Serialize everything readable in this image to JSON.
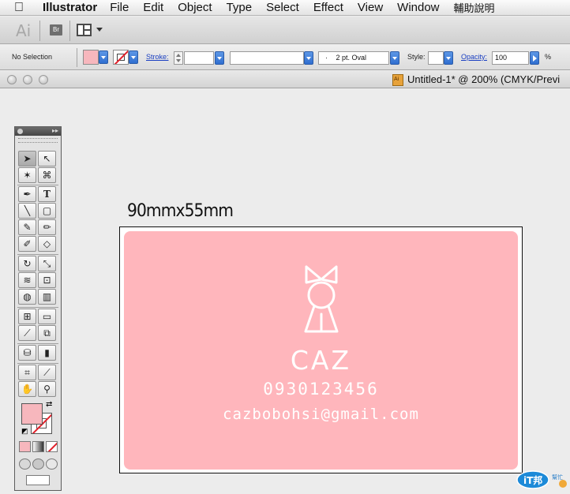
{
  "menubar": {
    "app_name": "Illustrator",
    "items": [
      "File",
      "Edit",
      "Object",
      "Type",
      "Select",
      "Effect",
      "View",
      "Window",
      "輔助說明"
    ]
  },
  "appbar": {
    "logo": "Ai",
    "bridge": "Br"
  },
  "control": {
    "selection": "No Selection",
    "stroke_label": "Stroke:",
    "stroke_weight": "",
    "brush_preset": "",
    "brush": "2 pt. Oval",
    "style_label": "Style:",
    "opacity_label": "Opacity:",
    "opacity_value": "100",
    "percent": "%",
    "fill_color": "#f7b7bd"
  },
  "document": {
    "title": "Untitled-1* @ 200% (CMYK/Previ"
  },
  "artboard": {
    "label": "90mmx55mm",
    "card_color": "#ffb6bc",
    "card": {
      "name": "CAZ",
      "phone": "0930123456",
      "email": "cazbobohsi@gmail.com"
    }
  },
  "tools": {
    "fill_color": "#f7b7bd",
    "stroke": "none"
  },
  "watermark": {
    "text": "iT邦",
    "sub": "幫忙"
  }
}
